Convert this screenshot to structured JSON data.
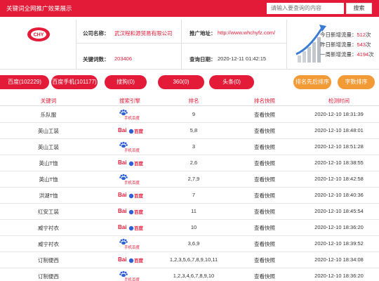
{
  "header": {
    "title": "关键词全网推广效果展示",
    "search_placeholder": "请输入要查询的内容",
    "search_button": "搜索"
  },
  "company": {
    "logo_text": "CHY",
    "name_label": "公司名称：",
    "name_value": "武汉程和源贸易有限公司",
    "keyword_count_label": "关键词数：",
    "keyword_count_value": "203406",
    "site_label": "推广地址：",
    "site_value": "http://www.whchyfz.com/",
    "query_date_label": "查询日期：",
    "query_date_value": "2020-12-11 01:42:15"
  },
  "stats": {
    "today_label": "今日新增流量：",
    "today_value": "512",
    "yesterday_label": "昨日新增流量：",
    "yesterday_value": "543",
    "week_label": "一周新增流量：",
    "week_value": "4194",
    "unit": "次"
  },
  "engine_tabs": [
    {
      "label": "百度(102229)"
    },
    {
      "label": "百度手机(101177)"
    },
    {
      "label": "搜狗(0)"
    },
    {
      "label": "360(0)"
    },
    {
      "label": "头条(0)"
    }
  ],
  "sort_buttons": [
    {
      "label": "排名先后排序"
    },
    {
      "label": "字数排序"
    }
  ],
  "table": {
    "columns": [
      "关键词",
      "搜索引擎",
      "排名",
      "排名快照",
      "检测时间"
    ],
    "engine_baidu_text": "Bai",
    "engine_baidu_text2": "百度",
    "engine_mobile_text": "手机百度",
    "rows": [
      {
        "keyword": "乐队服",
        "engine": "mobile",
        "rank": "9",
        "snapshot": "查看快照",
        "time": "2020-12-10 18:31:39"
      },
      {
        "keyword": "英山工装",
        "engine": "baidu",
        "rank": "5,8",
        "snapshot": "查看快照",
        "time": "2020-12-10 18:48:01"
      },
      {
        "keyword": "英山工装",
        "engine": "mobile",
        "rank": "3",
        "snapshot": "查看快照",
        "time": "2020-12-10 18:51:28"
      },
      {
        "keyword": "英山T恤",
        "engine": "baidu",
        "rank": "2,6",
        "snapshot": "查看快照",
        "time": "2020-12-10 18:38:55"
      },
      {
        "keyword": "英山T恤",
        "engine": "mobile",
        "rank": "2,7,9",
        "snapshot": "查看快照",
        "time": "2020-12-10 18:42:58"
      },
      {
        "keyword": "洪湖T恤",
        "engine": "baidu",
        "rank": "7",
        "snapshot": "查看快照",
        "time": "2020-12-10 18:40:36"
      },
      {
        "keyword": "红安工装",
        "engine": "baidu",
        "rank": "11",
        "snapshot": "查看快照",
        "time": "2020-12-10 18:45:54"
      },
      {
        "keyword": "威宁衬衣",
        "engine": "baidu",
        "rank": "10",
        "snapshot": "查看快照",
        "time": "2020-12-10 18:36:20"
      },
      {
        "keyword": "威宁衬衣",
        "engine": "mobile",
        "rank": "3,6,9",
        "snapshot": "查看快照",
        "time": "2020-12-10 18:39:52"
      },
      {
        "keyword": "订制便西",
        "engine": "baidu",
        "rank": "1,2,3,5,6,7,8,9,10,11",
        "snapshot": "查看快照",
        "time": "2020-12-10 18:34:08"
      },
      {
        "keyword": "订制便西",
        "engine": "mobile",
        "rank": "1,2,3,4,6,7,8,9,10",
        "snapshot": "查看快照",
        "time": "2020-12-10 18:36:20"
      }
    ]
  }
}
